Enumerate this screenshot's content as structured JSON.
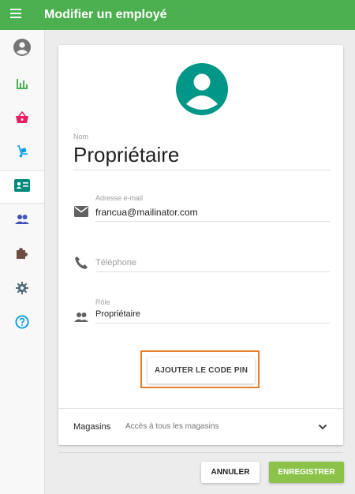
{
  "appbar": {
    "title": "Modifier un employé",
    "menu_icon": "menu-icon",
    "color": "#4caf50"
  },
  "sidebar": {
    "items": [
      {
        "name": "account-circle-icon",
        "color": "#757575",
        "active": false
      },
      {
        "name": "bar-chart-icon",
        "color": "#4caf50",
        "active": false
      },
      {
        "name": "basket-icon",
        "color": "#e91e63",
        "active": false
      },
      {
        "name": "hand-truck-icon",
        "color": "#039be5",
        "active": false
      },
      {
        "name": "badge-card-icon",
        "color": "#00897b",
        "active": true
      },
      {
        "name": "people-icon",
        "color": "#3f51b5",
        "active": false
      },
      {
        "name": "puzzle-icon",
        "color": "#6d4c41",
        "active": false
      },
      {
        "name": "gear-icon",
        "color": "#546e7a",
        "active": false
      },
      {
        "name": "help-circle-icon",
        "color": "#039be5",
        "active": false
      }
    ]
  },
  "form": {
    "avatar_color": "#009688",
    "name_label": "Nom",
    "name_value": "Propriétaire",
    "email_label": "Adresse e-mail",
    "email_value": "francua@mailinator.com",
    "phone_placeholder": "Téléphone",
    "role_label": "Rôle",
    "role_value": "Propriétaire",
    "pin_button": "AJOUTER LE CODE PIN",
    "stores_label": "Magasins",
    "stores_value": "Accès à tous les magasins"
  },
  "footer": {
    "cancel": "ANNULER",
    "save": "ENREGISTRER",
    "save_color": "#8bc34a"
  },
  "highlight_color": "#e87c2a"
}
